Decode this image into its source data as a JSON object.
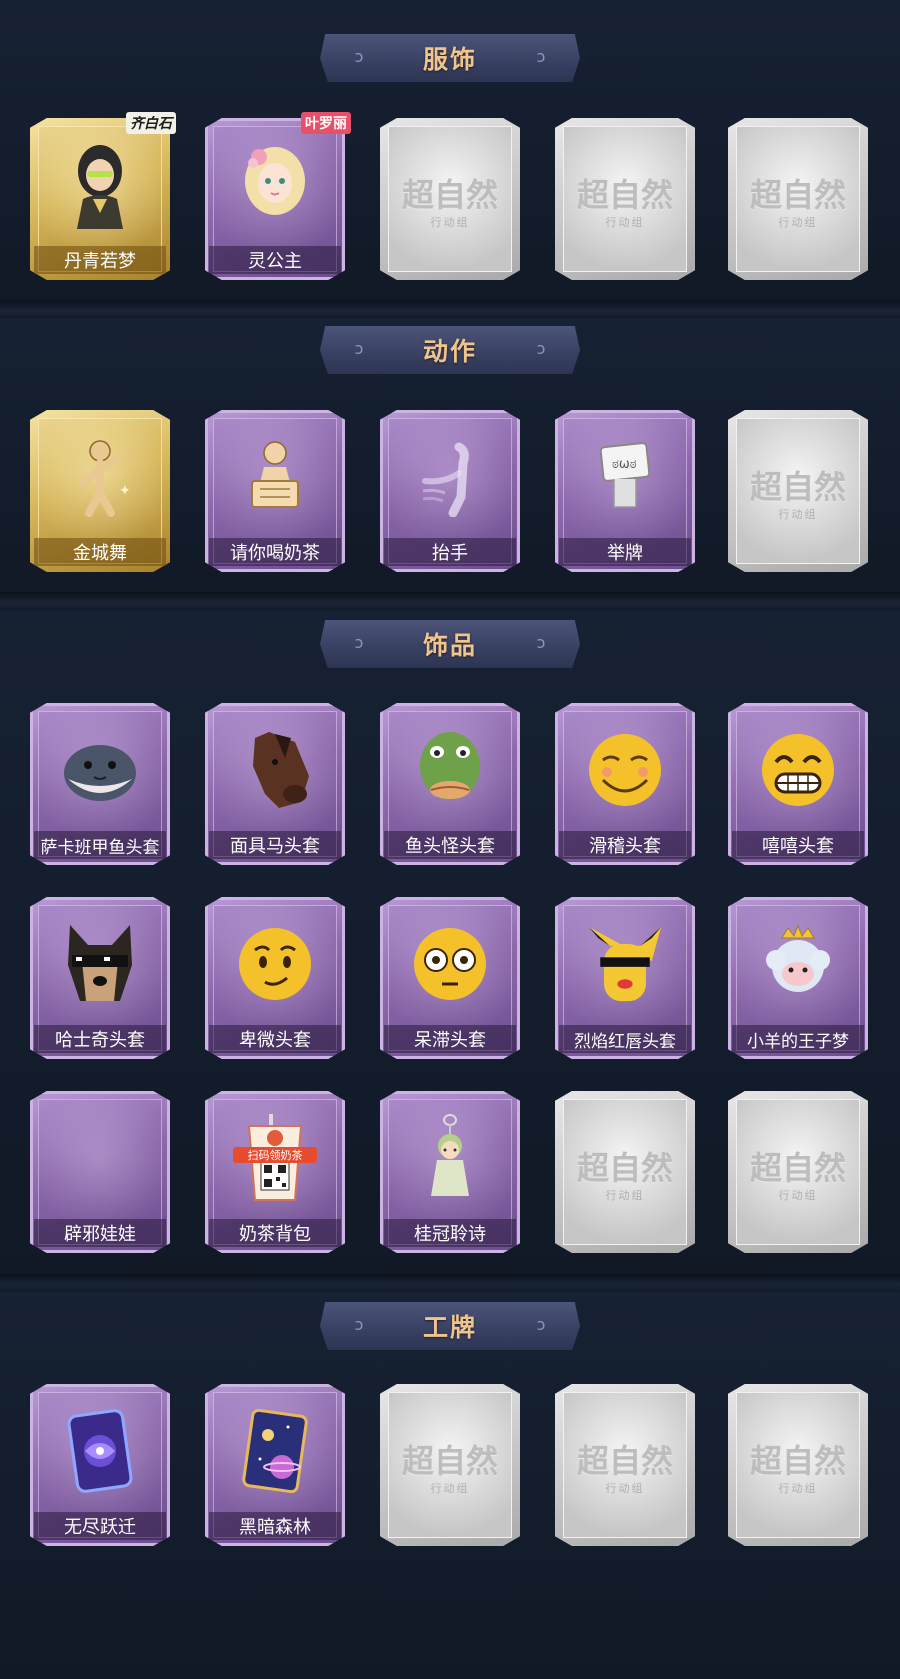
{
  "sections": {
    "costume": {
      "title": "服饰",
      "items": [
        {
          "label": "丹青若梦",
          "rarity": "gold",
          "brand": "齐白石",
          "icon": "character-portrait-icon"
        },
        {
          "label": "灵公主",
          "rarity": "purple",
          "brand": "叶罗丽",
          "icon": "character-portrait-icon"
        },
        {
          "label": "",
          "rarity": "locked",
          "placeholder": "超自然",
          "placeholder_sub": "行动组"
        },
        {
          "label": "",
          "rarity": "locked",
          "placeholder": "超自然",
          "placeholder_sub": "行动组"
        },
        {
          "label": "",
          "rarity": "locked",
          "placeholder": "超自然",
          "placeholder_sub": "行动组"
        }
      ]
    },
    "action": {
      "title": "动作",
      "items": [
        {
          "label": "金城舞",
          "rarity": "gold",
          "icon": "dance-pose-icon"
        },
        {
          "label": "请你喝奶茶",
          "rarity": "purple",
          "icon": "hold-sign-icon"
        },
        {
          "label": "抬手",
          "rarity": "purple",
          "icon": "raise-hand-icon"
        },
        {
          "label": "举牌",
          "rarity": "purple",
          "icon": "sign-board-icon"
        },
        {
          "label": "",
          "rarity": "locked",
          "placeholder": "超自然",
          "placeholder_sub": "行动组"
        }
      ]
    },
    "accessory": {
      "title": "饰品",
      "rows": [
        [
          {
            "label": "萨卡班甲鱼头套",
            "rarity": "purple",
            "icon": "fish-head-icon"
          },
          {
            "label": "面具马头套",
            "rarity": "purple",
            "icon": "horse-head-icon"
          },
          {
            "label": "鱼头怪头套",
            "rarity": "purple",
            "icon": "fish-monster-icon"
          },
          {
            "label": "滑稽头套",
            "rarity": "purple",
            "icon": "funny-face-icon"
          },
          {
            "label": "嘻嘻头套",
            "rarity": "purple",
            "icon": "grin-face-icon"
          }
        ],
        [
          {
            "label": "哈士奇头套",
            "rarity": "purple",
            "icon": "dog-head-icon"
          },
          {
            "label": "卑微头套",
            "rarity": "purple",
            "icon": "humble-face-icon"
          },
          {
            "label": "呆滞头套",
            "rarity": "purple",
            "icon": "stunned-face-icon"
          },
          {
            "label": "烈焰红唇头套",
            "rarity": "purple",
            "icon": "yellow-mask-icon"
          },
          {
            "label": "小羊的王子梦",
            "rarity": "purple",
            "icon": "sheep-crown-icon"
          }
        ],
        [
          {
            "label": "辟邪娃娃",
            "rarity": "purple",
            "icon": "empty-slot-icon"
          },
          {
            "label": "奶茶背包",
            "rarity": "purple",
            "icon": "milk-tea-bag-icon",
            "badge": "扫码领奶茶"
          },
          {
            "label": "桂冠聆诗",
            "rarity": "purple",
            "icon": "charm-pendant-icon"
          },
          {
            "label": "",
            "rarity": "locked",
            "placeholder": "超自然",
            "placeholder_sub": "行动组"
          },
          {
            "label": "",
            "rarity": "locked",
            "placeholder": "超自然",
            "placeholder_sub": "行动组"
          }
        ]
      ]
    },
    "badge": {
      "title": "工牌",
      "items": [
        {
          "label": "无尽跃迁",
          "rarity": "purple",
          "icon": "galaxy-card-icon"
        },
        {
          "label": "黑暗森林",
          "rarity": "purple",
          "icon": "space-card-icon"
        },
        {
          "label": "",
          "rarity": "locked",
          "placeholder": "超自然",
          "placeholder_sub": "行动组"
        },
        {
          "label": "",
          "rarity": "locked",
          "placeholder": "超自然",
          "placeholder_sub": "行动组"
        },
        {
          "label": "",
          "rarity": "locked",
          "placeholder": "超自然",
          "placeholder_sub": "行动组"
        }
      ]
    }
  },
  "colors": {
    "background": "#121a26",
    "header_text": "#f0c48a",
    "rarity_gold": "#d9b95d",
    "rarity_purple": "#8f6aad",
    "locked_gray": "#c9c9c9"
  }
}
